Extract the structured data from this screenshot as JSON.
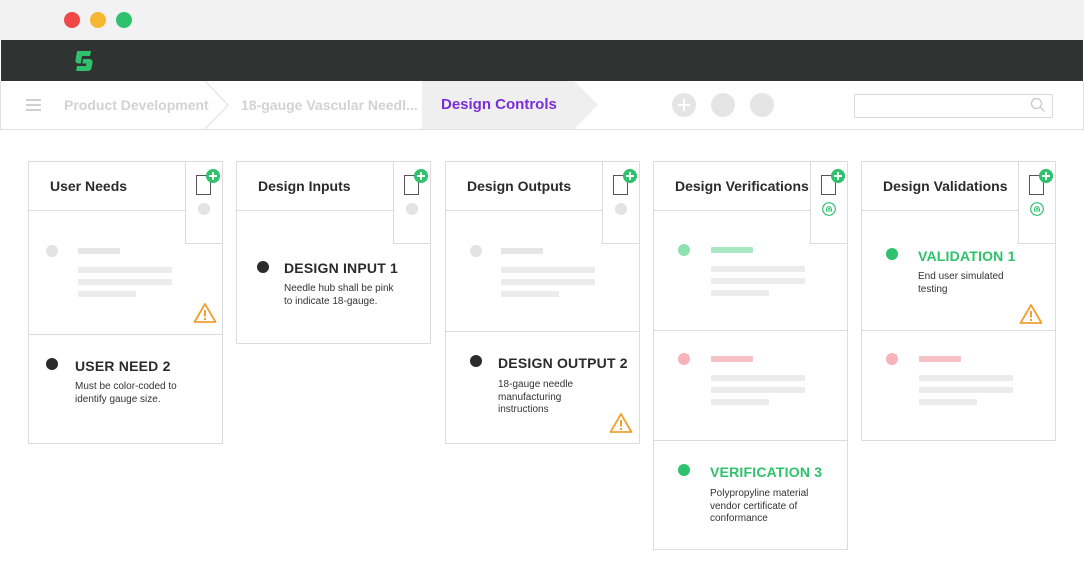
{
  "window": {
    "controls": [
      "close",
      "minimize",
      "maximize"
    ]
  },
  "app": {
    "logo_icon": "greenlight-logo-icon"
  },
  "breadcrumb": {
    "items": [
      "Product Development",
      "18-gauge Vascular Needl..."
    ],
    "active": "Design Controls"
  },
  "toolbar": {
    "buttons": [
      "add-icon",
      "circle-icon",
      "circle-icon"
    ]
  },
  "search": {
    "placeholder": "",
    "icon": "search-icon"
  },
  "colors": {
    "accent": "#7a2fd6",
    "green": "#2dc26b",
    "warning": "#f0a030",
    "pink": "#f6b3b8",
    "dark": "#2f3331"
  },
  "columns": [
    {
      "title": "User Needs",
      "cards": [
        {
          "kind": "placeholder",
          "warning": true
        },
        {
          "kind": "item",
          "title": "USER NEED 2",
          "desc": "Must be color-coded to identify gauge size."
        }
      ]
    },
    {
      "title": "Design Inputs",
      "cards": [
        {
          "kind": "item",
          "title": "DESIGN INPUT 1",
          "desc": "Needle hub shall be pink to indicate 18-gauge."
        }
      ]
    },
    {
      "title": "Design Outputs",
      "cards": [
        {
          "kind": "placeholder"
        },
        {
          "kind": "item",
          "title": "DESIGN OUTPUT 2",
          "desc": "18-gauge needle manufacturing instructions",
          "warning": true
        }
      ]
    },
    {
      "title": "Design Verifications",
      "cards": [
        {
          "kind": "placeholder",
          "status": "pass"
        },
        {
          "kind": "placeholder",
          "status": "fail"
        },
        {
          "kind": "item",
          "title": "VERIFICATION 3",
          "desc": "Polypropyline material vendor certificate of conformance",
          "status": "pass"
        }
      ]
    },
    {
      "title": "Design Validations",
      "cards": [
        {
          "kind": "item",
          "title": "VALIDATION 1",
          "desc": "End user simulated testing",
          "status": "pass",
          "warning": true
        },
        {
          "kind": "placeholder",
          "status": "fail"
        }
      ]
    }
  ]
}
